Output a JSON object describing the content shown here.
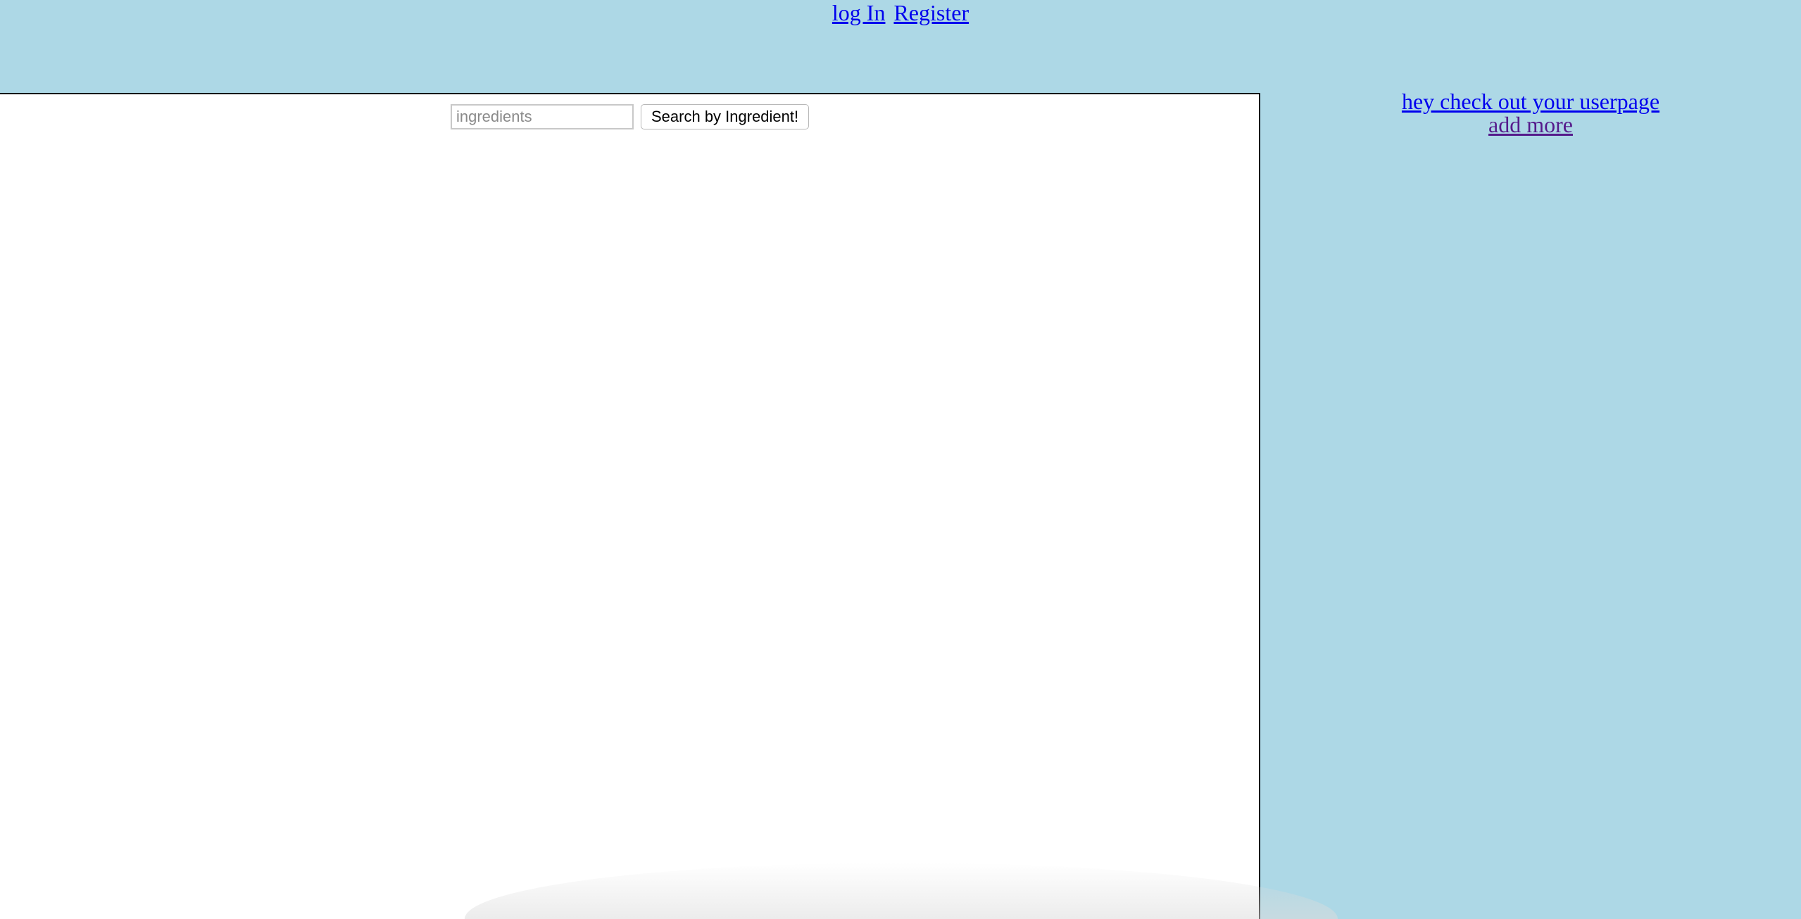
{
  "nav": {
    "login_label": "log In",
    "register_label": "Register"
  },
  "search": {
    "placeholder": "ingredients",
    "value": "",
    "button_label": "Search by Ingredient!"
  },
  "sidebar": {
    "userpage_link": "hey check out your userpage",
    "add_more_link": "add more"
  },
  "colors": {
    "page_background": "#add8e6",
    "link": "#0000ee",
    "visited_link": "#551a8b",
    "panel_background": "#ffffff"
  }
}
